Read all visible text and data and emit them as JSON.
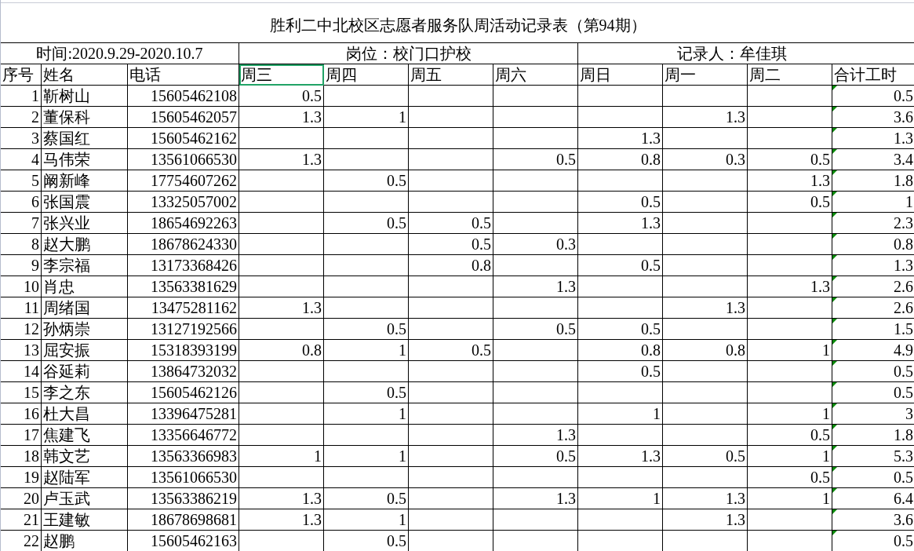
{
  "title": "胜利二中北校区志愿者服务队周活动记录表（第94期）",
  "info": {
    "time": "时间:2020.9.29-2020.10.7",
    "post": "岗位：校门口护校",
    "recorder": "记录人：牟佳琪"
  },
  "columns": [
    {
      "label": "序号",
      "selected": false
    },
    {
      "label": "姓名",
      "selected": false
    },
    {
      "label": "电话",
      "selected": false
    },
    {
      "label": "周三",
      "selected": true
    },
    {
      "label": "周四",
      "selected": false
    },
    {
      "label": "周五",
      "selected": false
    },
    {
      "label": "周六",
      "selected": false
    },
    {
      "label": "周日",
      "selected": false
    },
    {
      "label": "周一",
      "selected": false
    },
    {
      "label": "周二",
      "selected": false
    },
    {
      "label": "合计工时",
      "selected": false
    }
  ],
  "rows": [
    {
      "no": "1",
      "name": "靳树山",
      "phone": "15605462108",
      "wed": "0.5",
      "total": "0.5",
      "flagged": true
    },
    {
      "no": "2",
      "name": "董保科",
      "phone": "15605462057",
      "wed": "1.3",
      "thu": "1",
      "mon": "1.3",
      "total": "3.6",
      "flagged": true
    },
    {
      "no": "3",
      "name": "蔡国红",
      "phone": "15605462162",
      "sun": "1.3",
      "total": "1.3",
      "flagged": true
    },
    {
      "no": "4",
      "name": "马伟荣",
      "phone": "13561066530",
      "wed": "1.3",
      "sat": "0.5",
      "sun": "0.8",
      "mon": "0.3",
      "tue": "0.5",
      "total": "3.4",
      "flagged": true
    },
    {
      "no": "5",
      "name": "阚新峰",
      "phone": "17754607262",
      "thu": "0.5",
      "tue": "1.3",
      "total": "1.8",
      "flagged": true
    },
    {
      "no": "6",
      "name": "张国震",
      "phone": "13325057002",
      "sun": "0.5",
      "tue": "0.5",
      "total": "1",
      "flagged": true
    },
    {
      "no": "7",
      "name": "张兴业",
      "phone": "18654692263",
      "thu": "0.5",
      "fri": "0.5",
      "sun": "1.3",
      "total": "2.3",
      "flagged": true
    },
    {
      "no": "8",
      "name": "赵大鹏",
      "phone": "18678624330",
      "fri": "0.5",
      "sat": "0.3",
      "total": "0.8",
      "flagged": true
    },
    {
      "no": "9",
      "name": "李宗福",
      "phone": "13173368426",
      "fri": "0.8",
      "sun": "0.5",
      "total": "1.3",
      "flagged": true
    },
    {
      "no": "10",
      "name": "肖忠",
      "phone": "13563381629",
      "sat": "1.3",
      "tue": "1.3",
      "total": "2.6",
      "flagged": true
    },
    {
      "no": "11",
      "name": "周绪国",
      "phone": "13475281162",
      "wed": "1.3",
      "mon": "1.3",
      "total": "2.6",
      "flagged": true
    },
    {
      "no": "12",
      "name": "孙炳崇",
      "phone": "13127192566",
      "thu": "0.5",
      "sat": "0.5",
      "sun": "0.5",
      "total": "1.5",
      "flagged": true
    },
    {
      "no": "13",
      "name": "屈安振",
      "phone": "15318393199",
      "wed": "0.8",
      "thu": "1",
      "fri": "0.5",
      "sun": "0.8",
      "mon": "0.8",
      "tue": "1",
      "total": "4.9",
      "flagged": true
    },
    {
      "no": "14",
      "name": "谷延莉",
      "phone": "13864732032",
      "sun": "0.5",
      "total": "0.5",
      "flagged": true
    },
    {
      "no": "15",
      "name": "李之东",
      "phone": "15605462126",
      "thu": "0.5",
      "total": "0.5",
      "flagged": true
    },
    {
      "no": "16",
      "name": "杜大昌",
      "phone": "13396475281",
      "thu": "1",
      "sun": "1",
      "tue": "1",
      "total": "3",
      "flagged": true
    },
    {
      "no": "17",
      "name": "焦建飞",
      "phone": "13356646772",
      "sat": "1.3",
      "tue": "0.5",
      "total": "1.8",
      "flagged": true
    },
    {
      "no": "18",
      "name": "韩文艺",
      "phone": "13563366983",
      "wed": "1",
      "thu": "1",
      "sat": "0.5",
      "sun": "1.3",
      "mon": "0.5",
      "tue": "1",
      "total": "5.3",
      "flagged": true
    },
    {
      "no": "19",
      "name": "赵陆军",
      "phone": "13561066530",
      "tue": "0.5",
      "total": "0.5",
      "flagged": true
    },
    {
      "no": "20",
      "name": "卢玉武",
      "phone": "13563386219",
      "wed": "1.3",
      "thu": "0.5",
      "sat": "1.3",
      "sun": "1",
      "mon": "1.3",
      "tue": "1",
      "total": "6.4",
      "flagged": true
    },
    {
      "no": "21",
      "name": "王建敏",
      "phone": "18678698681",
      "wed": "1.3",
      "thu": "1",
      "mon": "1.3",
      "total": "3.6",
      "flagged": true
    },
    {
      "no": "22",
      "name": "赵鹏",
      "phone": "15605462163",
      "thu": "0.5",
      "total": "0.5",
      "flagged": true
    }
  ]
}
